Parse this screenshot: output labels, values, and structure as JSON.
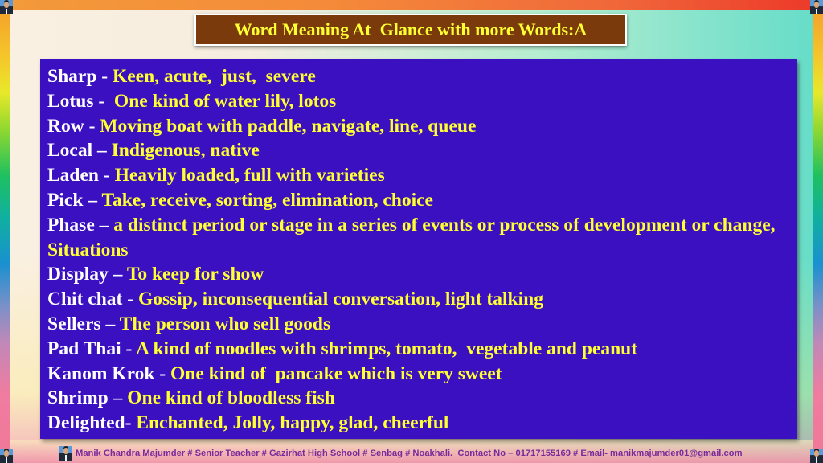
{
  "slide": {
    "title": "Word Meaning At  Glance with more Words:A",
    "colors": {
      "title_bg": "#7a3a0c",
      "title_text": "#ffff33",
      "content_bg": "#3a10c0",
      "term_text": "#ffffff",
      "meaning_text": "#ffff33",
      "footer_text": "#7a2a9a"
    },
    "entries": [
      {
        "term": "Sharp",
        "sep": " - ",
        "meaning": "Keen, acute,  just,  severe"
      },
      {
        "term": "Lotus",
        "sep": " -  ",
        "meaning": "One kind of water lily, lotos"
      },
      {
        "term": "Row",
        "sep": " - ",
        "meaning": "Moving boat with paddle, navigate, line, queue"
      },
      {
        "term": "Local",
        "sep": " – ",
        "meaning": "Indigenous, native"
      },
      {
        "term": "Laden",
        "sep": " - ",
        "meaning": "Heavily loaded, full with varieties"
      },
      {
        "term": "Pick",
        "sep": " – ",
        "meaning": "Take, receive, sorting, elimination, choice"
      },
      {
        "term": "Phase",
        "sep": " – ",
        "meaning": "a distinct period or stage in a series of events or process of development or change, Situations"
      },
      {
        "term": "Display",
        "sep": " – ",
        "meaning": "To keep for show"
      },
      {
        "term": "Chit chat",
        "sep": " - ",
        "meaning": "Gossip, inconsequential conversation, light talking"
      },
      {
        "term": "Sellers",
        "sep": " – ",
        "meaning": "The person who sell goods"
      },
      {
        "term": "Pad Thai",
        "sep": " - ",
        "meaning": "A kind of noodles with shrimps, tomato,  vegetable and peanut"
      },
      {
        "term": "Kanom Krok",
        "sep": " - ",
        "meaning": "One kind of  pancake which is very sweet"
      },
      {
        "term": "Shrimp",
        "sep": " – ",
        "meaning": "One kind of bloodless fish"
      },
      {
        "term": "Delighted",
        "sep": "- ",
        "meaning": "Enchanted, Jolly, happy, glad, cheerful"
      }
    ]
  },
  "footer": {
    "text": "Manik Chandra Majumder # Senior Teacher # Gazirhat High School # Senbag # Noakhali.  Contact No – 01717155169 # Email- manikmajumder01@gmail.com",
    "photo_icon": "author-photo-icon"
  },
  "decorations": {
    "corner_icons": [
      "author-photo-icon",
      "author-photo-icon",
      "author-photo-icon",
      "author-photo-icon"
    ]
  }
}
